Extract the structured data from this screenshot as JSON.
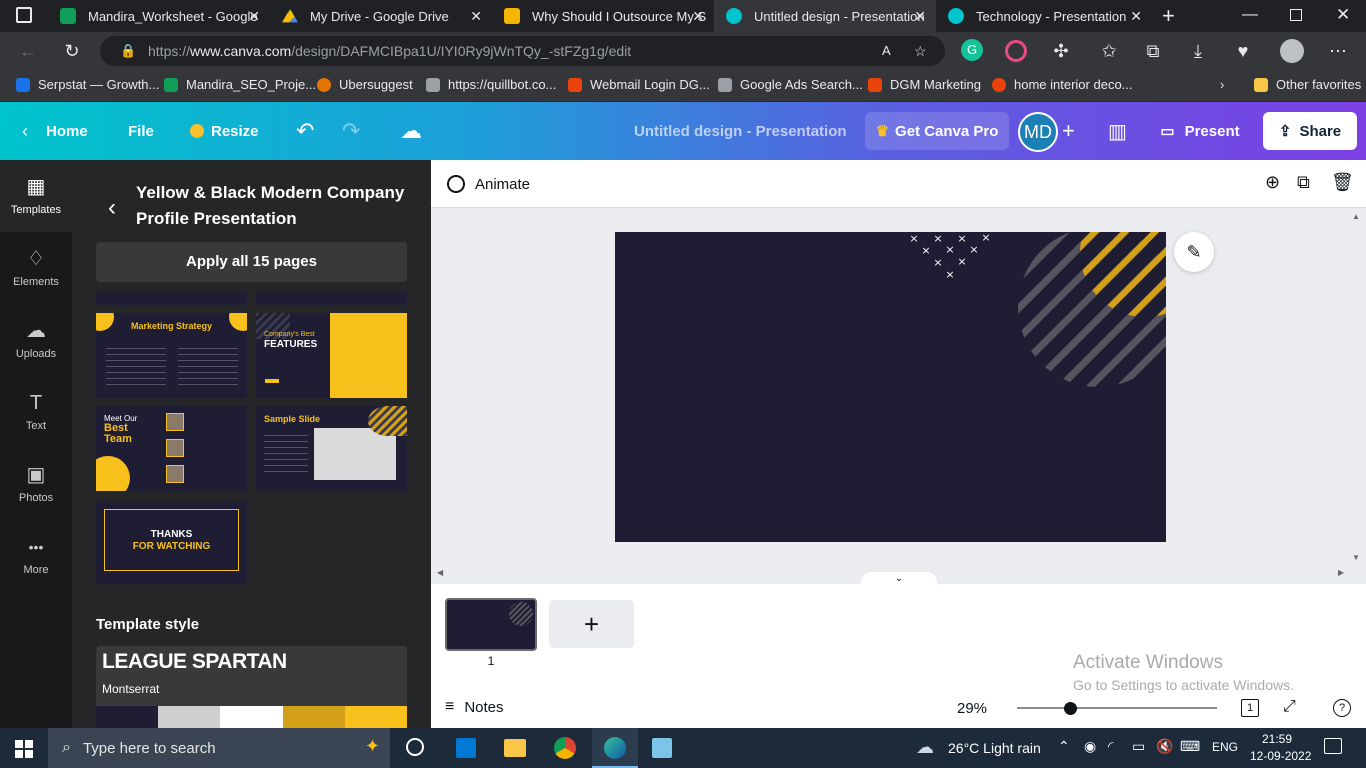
{
  "browser": {
    "tabs": [
      {
        "title": "Mandira_Worksheet - Google",
        "icon": "sheets-icon",
        "color": "#0f9d58"
      },
      {
        "title": "My Drive - Google Drive",
        "icon": "drive-icon",
        "color": "#fbbc04"
      },
      {
        "title": "Why Should I Outsource My S",
        "icon": "slides-icon",
        "color": "#f4b400"
      },
      {
        "title": "Untitled design - Presentation",
        "icon": "canva-icon",
        "color": "#00c4cc"
      },
      {
        "title": "Technology - Presentation",
        "icon": "canva-icon",
        "color": "#00c4cc"
      }
    ],
    "url_prefix": "https://",
    "url_domain": "www.canva.com",
    "url_path": "/design/DAFMCIBpa1U/IYI0Ry9jWnTQy_-stFZg1g/edit",
    "bookmarks": [
      {
        "label": "Serpstat — Growth...",
        "color": "#1a73e8"
      },
      {
        "label": "Mandira_SEO_Proje...",
        "color": "#0f9d58"
      },
      {
        "label": "Ubersuggest",
        "color": "#e37400"
      },
      {
        "label": "https://quillbot.co...",
        "color": "#9aa0a6"
      },
      {
        "label": "Webmail Login DG...",
        "color": "#e8430b"
      },
      {
        "label": "Google Ads Search...",
        "color": "#9aa0a6"
      },
      {
        "label": "DGM Marketing",
        "color": "#e8430b"
      },
      {
        "label": "home interior deco...",
        "color": "#9aa0a6"
      }
    ],
    "other_favorites": "Other favorites"
  },
  "canva": {
    "home": "Home",
    "file": "File",
    "resize": "Resize",
    "doc_title": "Untitled design - Presentation",
    "get_pro": "Get Canva Pro",
    "avatar_initials": "MD",
    "present": "Present",
    "share": "Share"
  },
  "rail": [
    {
      "label": "Templates",
      "icon": "templates-icon",
      "glyph": "▦"
    },
    {
      "label": "Elements",
      "icon": "elements-icon",
      "glyph": "♢"
    },
    {
      "label": "Uploads",
      "icon": "uploads-icon",
      "glyph": "☁"
    },
    {
      "label": "Text",
      "icon": "text-icon",
      "glyph": "T"
    },
    {
      "label": "Photos",
      "icon": "photos-icon",
      "glyph": "▣"
    },
    {
      "label": "More",
      "icon": "more-icon",
      "glyph": "•••"
    }
  ],
  "panel": {
    "template_title": "Yellow & Black Modern Company Profile Presentation",
    "apply_button": "Apply all 15 pages",
    "thumbs": {
      "marketing_title": "Marketing Strategy",
      "features_small": "Company's Best",
      "features_big": "FEATURES",
      "team_meet": "Meet Our",
      "team_best": "Best",
      "team_team": "Team",
      "sample_title": "Sample Slide",
      "thanks_line1": "THANKS",
      "thanks_line2": "FOR WATCHING"
    },
    "style_heading": "Template style",
    "font_heading": "LEAGUE SPARTAN",
    "font_body": "Montserrat",
    "palette": [
      "#1f1d33",
      "#cfcfcf",
      "#ffffff",
      "#d4a017",
      "#f7c01a"
    ]
  },
  "editor": {
    "animate": "Animate",
    "page_number": "1",
    "notes": "Notes",
    "zoom": "29%",
    "zoom_level": 0.29,
    "page_count_badge": "1",
    "watermark_title": "Activate Windows",
    "watermark_sub": "Go to Settings to activate Windows.",
    "slide_bg": "#1f1d33",
    "accent": "#f7c01a"
  },
  "taskbar": {
    "search_placeholder": "Type here to search",
    "weather": "26°C  Light rain",
    "language": "ENG",
    "time": "21:59",
    "date": "12-09-2022"
  }
}
